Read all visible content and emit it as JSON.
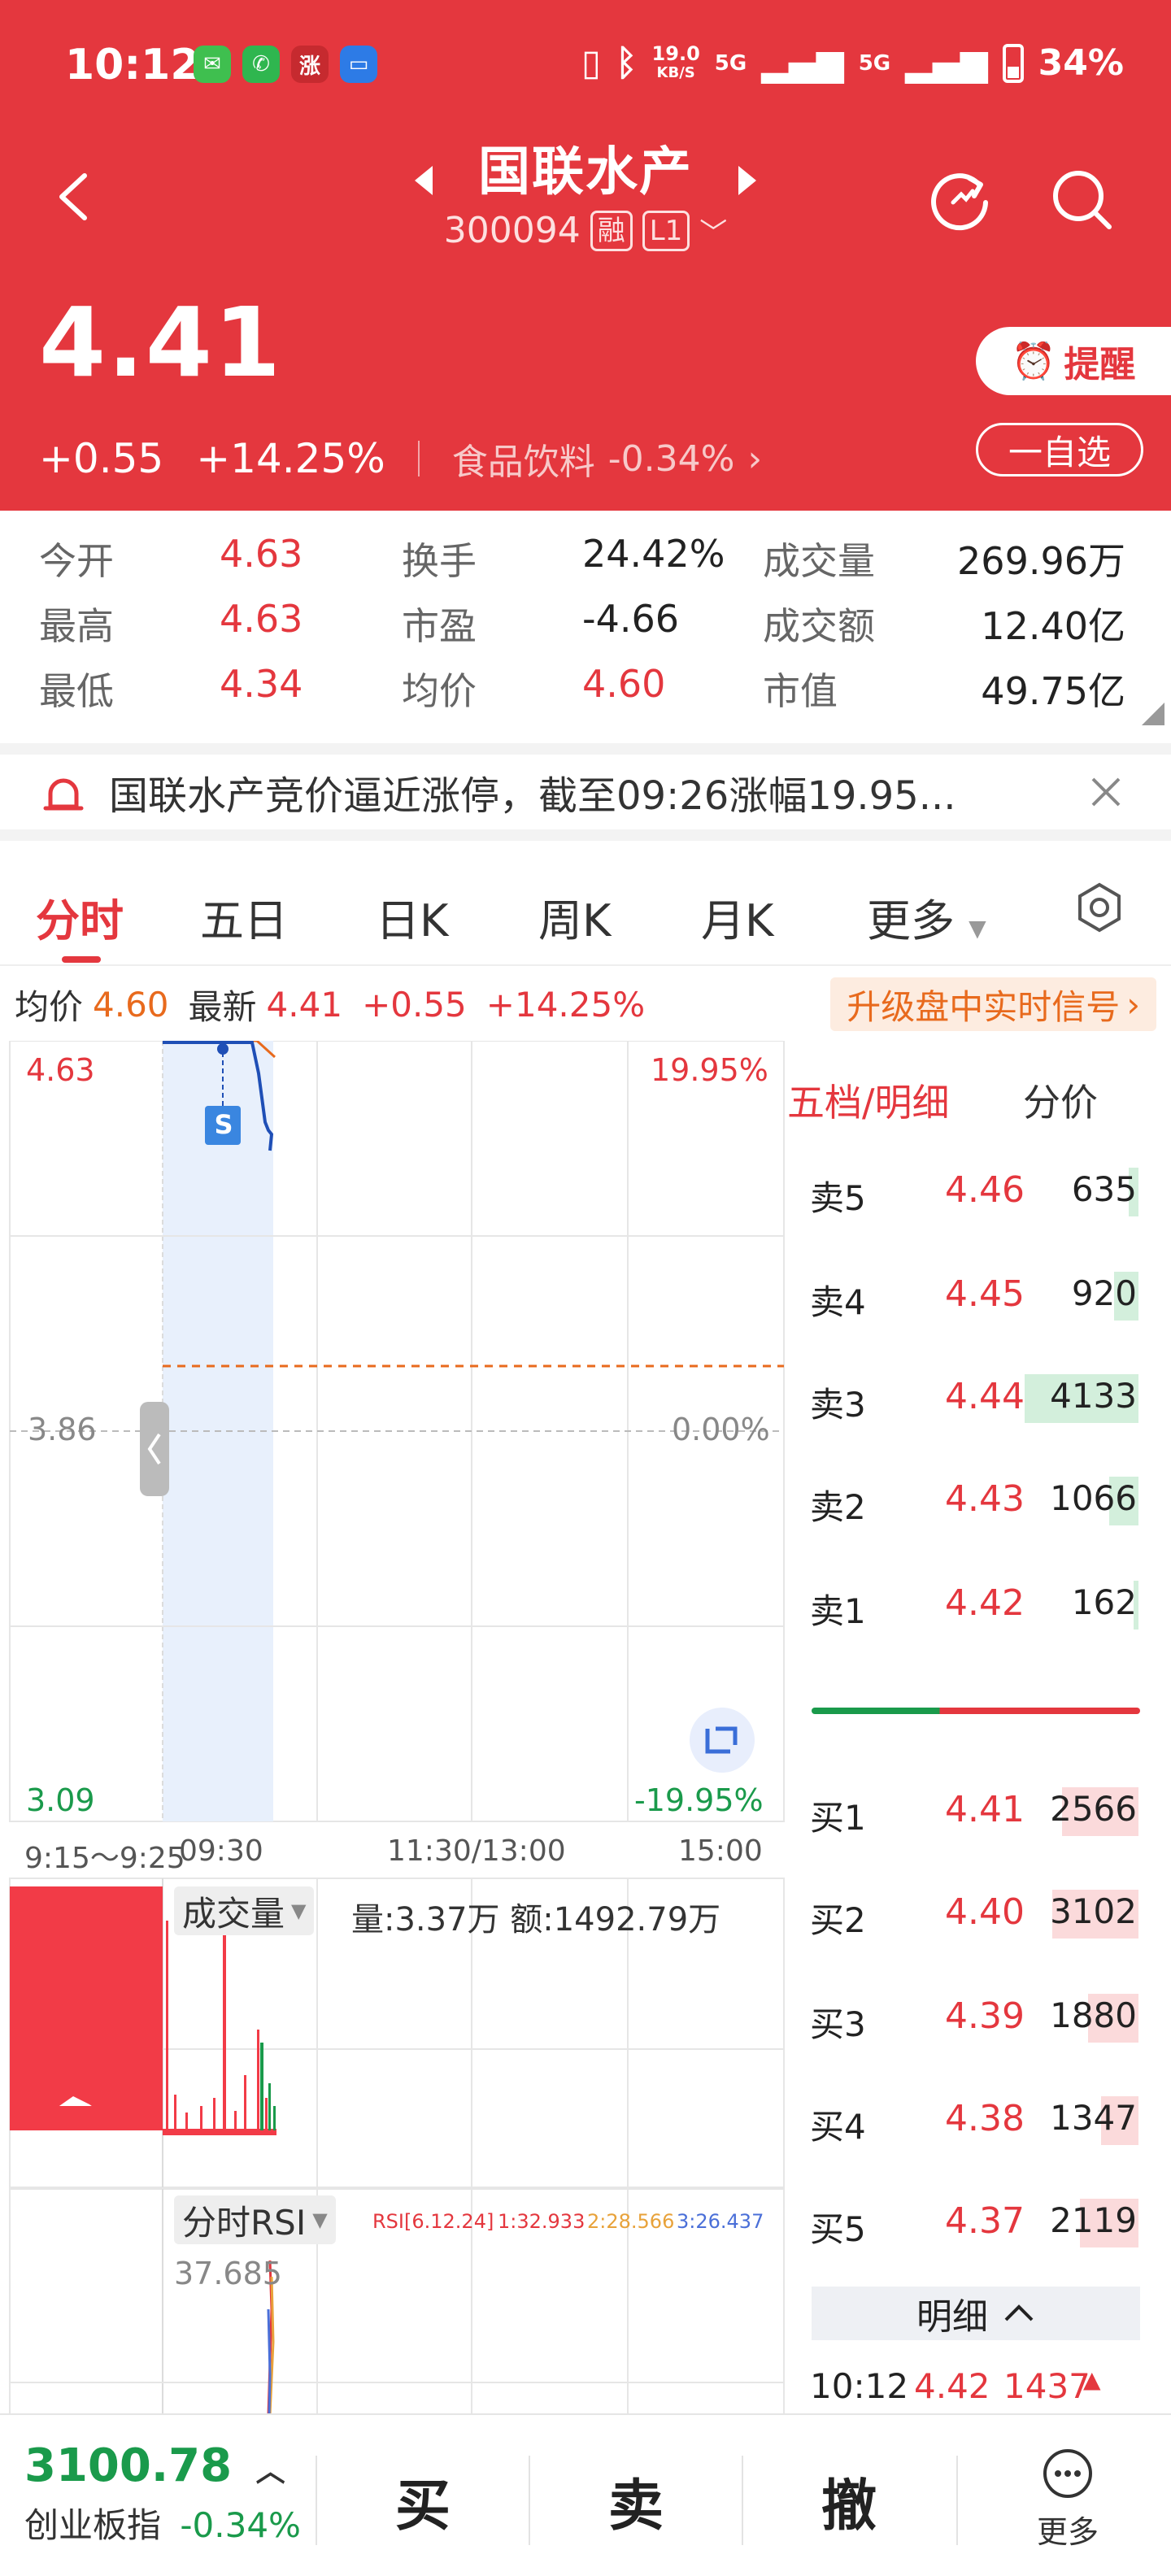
{
  "status": {
    "time": "10:12",
    "net_speed_top": "19.0",
    "net_speed_unit": "KB/S",
    "net1": "5G",
    "net2": "5G",
    "battery": "34%"
  },
  "header": {
    "title": "国联水产",
    "code": "300094",
    "tag_margin": "融",
    "tag_level": "L1",
    "price": "4.41",
    "change": "+0.55",
    "change_pct": "+14.25%",
    "sector": "食品饮料",
    "sector_pct": "-0.34%",
    "remind_label": "提醒",
    "watch_label": "一自选"
  },
  "stats": {
    "open_label": "今开",
    "open": "4.63",
    "turnover_label": "换手",
    "turnover": "24.42%",
    "volume_label": "成交量",
    "volume": "269.96万",
    "high_label": "最高",
    "high": "4.63",
    "pe_label": "市盈",
    "pe": "-4.66",
    "amount_label": "成交额",
    "amount": "12.40亿",
    "low_label": "最低",
    "low": "4.34",
    "avg_label": "均价",
    "avg": "4.60",
    "mktcap_label": "市值",
    "mktcap": "49.75亿"
  },
  "notice": {
    "text": "国联水产竞价逼近涨停，截至09:26涨幅19.95..."
  },
  "tabs": [
    "分时",
    "五日",
    "日K",
    "周K",
    "月K",
    "更多"
  ],
  "inforow": {
    "avg_label": "均价",
    "avg": "4.60",
    "latest_label": "最新",
    "latest": "4.41",
    "chg": "+0.55",
    "pct": "+14.25%",
    "upgrade": "升级盘中实时信号"
  },
  "chart": {
    "y_top": "4.63",
    "y_top_pct": "19.95%",
    "y_mid": "3.86",
    "y_mid_pct": "0.00%",
    "y_bot": "3.09",
    "y_bot_pct": "-19.95%",
    "t0": "9:15～9:25",
    "t1": "09:30",
    "t2": "11:30/13:00",
    "t3": "15:00",
    "marker": "S",
    "vol_chip": "成交量",
    "vol_info": "量:3.37万 额:1492.79万",
    "rsi_chip": "分时RSI",
    "rsi_params": "RSI[6.12.24]",
    "rsi1": "1:32.933",
    "rsi2": "2:28.566",
    "rsi3": "3:26.437",
    "rsi_value": "37.685"
  },
  "book": {
    "head_left": "五档/明细",
    "head_right": "分价",
    "asks": [
      {
        "label": "卖5",
        "price": "4.46",
        "vol": "635"
      },
      {
        "label": "卖4",
        "price": "4.45",
        "vol": "920"
      },
      {
        "label": "卖3",
        "price": "4.44",
        "vol": "4133"
      },
      {
        "label": "卖2",
        "price": "4.43",
        "vol": "1066"
      },
      {
        "label": "卖1",
        "price": "4.42",
        "vol": "162"
      }
    ],
    "bids": [
      {
        "label": "买1",
        "price": "4.41",
        "vol": "2566"
      },
      {
        "label": "买2",
        "price": "4.40",
        "vol": "3102"
      },
      {
        "label": "买3",
        "price": "4.39",
        "vol": "1880"
      },
      {
        "label": "买4",
        "price": "4.38",
        "vol": "1347"
      },
      {
        "label": "买5",
        "price": "4.37",
        "vol": "2119"
      }
    ],
    "detail_label": "明细",
    "tick": {
      "time": "10:12",
      "price": "4.42",
      "vol": "1437"
    }
  },
  "bottom": {
    "index_value": "3100.78",
    "index_name": "创业板指",
    "index_change": "-0.34%",
    "buy": "买",
    "sell": "卖",
    "cancel": "撤",
    "more": "更多"
  },
  "colors": {
    "header_bg": "#e4373e",
    "up": "#e4373e",
    "down": "#1a9a4b",
    "avg_line": "#e86a1d"
  }
}
